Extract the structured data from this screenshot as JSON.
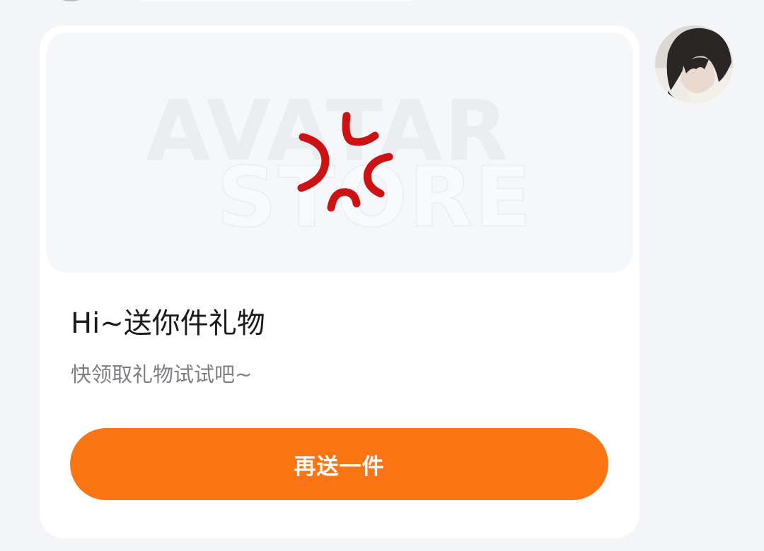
{
  "message": {
    "gift_card": {
      "image": {
        "icon": "anger-vein-icon",
        "watermark_line1": "AVATAR",
        "watermark_line2": "STORE"
      },
      "title": "Hi~送你件礼物",
      "subtitle": "快领取礼物试试吧~",
      "button_label": "再送一件"
    },
    "sender_avatar": "user-avatar-photo"
  },
  "colors": {
    "background": "#f4f5f8",
    "card": "#ffffff",
    "button": "#fb7515",
    "icon_red": "#cc1212",
    "title_text": "#1b1b1b",
    "subtitle_text": "#7d7f85"
  }
}
